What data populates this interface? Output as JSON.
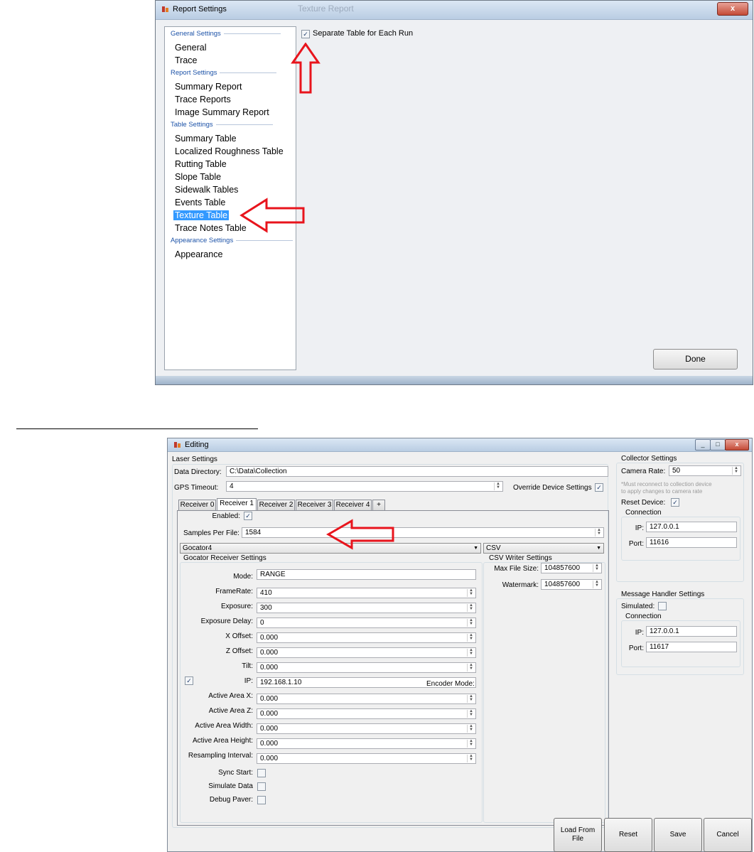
{
  "report_settings": {
    "title": "Report Settings",
    "ghost_title": "Texture Report",
    "close_label": "x",
    "nav": [
      {
        "type": "header",
        "label": "General Settings"
      },
      {
        "type": "item",
        "label": "General"
      },
      {
        "type": "item",
        "label": "Trace"
      },
      {
        "type": "header",
        "label": "Report Settings"
      },
      {
        "type": "item",
        "label": "Summary Report"
      },
      {
        "type": "item",
        "label": "Trace Reports"
      },
      {
        "type": "item",
        "label": "Image Summary Report"
      },
      {
        "type": "header",
        "label": "Table Settings"
      },
      {
        "type": "item",
        "label": "Summary Table"
      },
      {
        "type": "item",
        "label": "Localized Roughness Table"
      },
      {
        "type": "item",
        "label": "Rutting Table"
      },
      {
        "type": "item",
        "label": "Slope Table"
      },
      {
        "type": "item",
        "label": "Sidewalk Tables"
      },
      {
        "type": "item",
        "label": "Events Table"
      },
      {
        "type": "item",
        "label": "Texture Table",
        "selected": true
      },
      {
        "type": "item",
        "label": "Trace Notes Table"
      },
      {
        "type": "header",
        "label": "Appearance Settings"
      },
      {
        "type": "item",
        "label": "Appearance"
      }
    ],
    "separate_table_label": "Separate Table for Each Run",
    "separate_table_checked": true,
    "done_label": "Done"
  },
  "editing": {
    "title": "Editing",
    "laser": {
      "header": "Laser Settings",
      "data_directory_label": "Data Directory:",
      "data_directory_value": "C:\\Data\\Collection",
      "gps_timeout_label": "GPS Timeout:",
      "gps_timeout_value": "4",
      "override_label": "Override Device Settings",
      "override_checked": true,
      "tabs": [
        "Receiver 0",
        "Receiver 1",
        "Receiver 2",
        "Receiver 3",
        "Receiver 4",
        "+"
      ],
      "active_tab": 1,
      "enabled_label": "Enabled:",
      "enabled_checked": true,
      "samples_label": "Samples Per File:",
      "samples_value": "1584",
      "device_combo": "Gocator4",
      "writer_combo": "CSV",
      "gocator_header": "Gocator Receiver Settings",
      "gocator_fields": [
        {
          "label": "Mode:",
          "value": "RANGE"
        },
        {
          "label": "FrameRate:",
          "value": "410"
        },
        {
          "label": "Exposure:",
          "value": "300"
        },
        {
          "label": "Exposure Delay:",
          "value": "0"
        },
        {
          "label": "X Offset:",
          "value": "0.000"
        },
        {
          "label": "Z Offset:",
          "value": "0.000"
        },
        {
          "label": "Tilt:",
          "value": "0.000"
        },
        {
          "label": "IP:",
          "value": "192.168.1.10"
        }
      ],
      "encoder_mode_label": "Encoder Mode:",
      "encoder_checked": true,
      "area_fields": [
        {
          "label": "Active Area X:",
          "value": "0.000"
        },
        {
          "label": "Active Area Z:",
          "value": "0.000"
        },
        {
          "label": "Active Area Width:",
          "value": "0.000"
        },
        {
          "label": "Active Area Height:",
          "value": "0.000"
        },
        {
          "label": "Resampling Interval:",
          "value": "0.000"
        }
      ],
      "checks": [
        {
          "label": "Sync Start:",
          "checked": false
        },
        {
          "label": "Simulate Data",
          "checked": false
        },
        {
          "label": "Debug Paver:",
          "checked": false
        }
      ],
      "csv_header": "CSV Writer Settings",
      "max_file_size_label": "Max File Size:",
      "max_file_size_value": "104857600",
      "watermark_label": "Watermark:",
      "watermark_value": "104857600"
    },
    "collector": {
      "header": "Collector Settings",
      "camera_rate_label": "Camera Rate:",
      "camera_rate_value": "50",
      "note_line1": "*Must reconnect to collection device",
      "note_line2": "to apply changes to camera rate",
      "reset_device_label": "Reset Device:",
      "reset_device_checked": true,
      "connection_header": "Connection",
      "ip_label": "IP:",
      "ip_value": "127.0.0.1",
      "port_label": "Port:",
      "port_value": "11616"
    },
    "message_handler": {
      "header": "Message Handler Settings",
      "simulated_label": "Simulated:",
      "simulated_checked": false,
      "connection_header": "Connection",
      "ip_label": "IP:",
      "ip_value": "127.0.0.1",
      "port_label": "Port:",
      "port_value": "11617"
    },
    "buttons": {
      "load": "Load From File",
      "reset": "Reset",
      "save": "Save",
      "cancel": "Cancel"
    }
  },
  "colors": {
    "selection": "#3399ff",
    "annotation_arrow": "#e8141c",
    "section_header": "#1d53a8"
  }
}
